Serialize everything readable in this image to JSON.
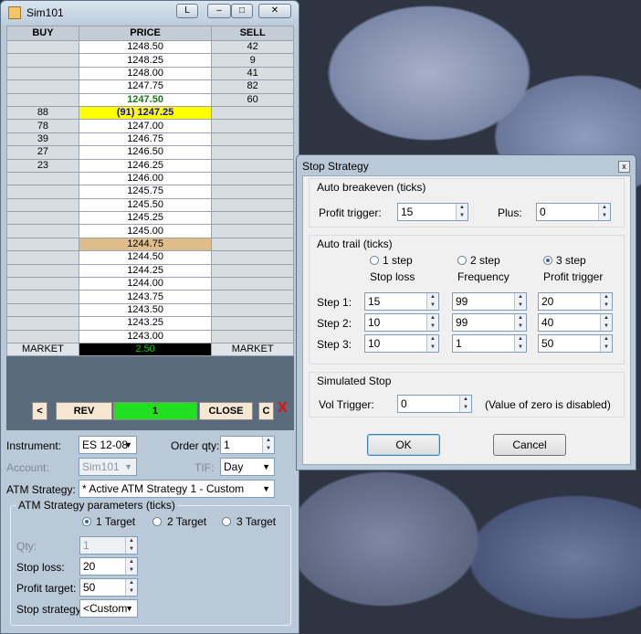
{
  "main_window": {
    "title": "Sim101",
    "btn_l": "L",
    "ladder": {
      "headers": {
        "buy": "BUY",
        "price": "PRICE",
        "sell": "SELL"
      },
      "rows": [
        {
          "buy": "",
          "price": "1248.50",
          "sell": "42",
          "style": ""
        },
        {
          "buy": "",
          "price": "1248.25",
          "sell": "9",
          "style": ""
        },
        {
          "buy": "",
          "price": "1248.00",
          "sell": "41",
          "style": ""
        },
        {
          "buy": "",
          "price": "1247.75",
          "sell": "82",
          "style": ""
        },
        {
          "buy": "",
          "price": "1247.50",
          "sell": "60",
          "style": "last"
        },
        {
          "buy": "88",
          "price": "(91) 1247.25",
          "sell": "",
          "style": "current"
        },
        {
          "buy": "78",
          "price": "1247.00",
          "sell": "",
          "style": ""
        },
        {
          "buy": "39",
          "price": "1246.75",
          "sell": "",
          "style": ""
        },
        {
          "buy": "27",
          "price": "1246.50",
          "sell": "",
          "style": ""
        },
        {
          "buy": "23",
          "price": "1246.25",
          "sell": "",
          "style": ""
        },
        {
          "buy": "",
          "price": "1246.00",
          "sell": "",
          "style": ""
        },
        {
          "buy": "",
          "price": "1245.75",
          "sell": "",
          "style": ""
        },
        {
          "buy": "",
          "price": "1245.50",
          "sell": "",
          "style": ""
        },
        {
          "buy": "",
          "price": "1245.25",
          "sell": "",
          "style": ""
        },
        {
          "buy": "",
          "price": "1245.00",
          "sell": "",
          "style": ""
        },
        {
          "buy": "",
          "price": "1244.75",
          "sell": "",
          "style": "highlight"
        },
        {
          "buy": "",
          "price": "1244.50",
          "sell": "",
          "style": ""
        },
        {
          "buy": "",
          "price": "1244.25",
          "sell": "",
          "style": ""
        },
        {
          "buy": "",
          "price": "1244.00",
          "sell": "",
          "style": ""
        },
        {
          "buy": "",
          "price": "1243.75",
          "sell": "",
          "style": ""
        },
        {
          "buy": "",
          "price": "1243.50",
          "sell": "",
          "style": ""
        },
        {
          "buy": "",
          "price": "1243.25",
          "sell": "",
          "style": ""
        },
        {
          "buy": "",
          "price": "1243.00",
          "sell": "",
          "style": ""
        }
      ],
      "footer": {
        "buy": "MARKET",
        "pnl": "2.50",
        "sell": "MARKET"
      }
    },
    "buttons": {
      "left": "<",
      "rev": "REV",
      "qty": "1",
      "close": "CLOSE",
      "c": "C",
      "x": "X"
    },
    "form": {
      "instrument_label": "Instrument:",
      "instrument_value": "ES 12-08",
      "order_qty_label": "Order qty:",
      "order_qty_value": "1",
      "account_label": "Account:",
      "account_value": "Sim101",
      "tif_label": "TIF:",
      "tif_value": "Day",
      "atm_label": "ATM Strategy:",
      "atm_value": "* Active ATM Strategy 1 - Custom",
      "params_title": "ATM Strategy parameters (ticks)",
      "target1": "1 Target",
      "target2": "2 Target",
      "target3": "3 Target",
      "qty_label": "Qty:",
      "qty_value": "1",
      "stop_loss_label": "Stop loss:",
      "stop_loss_value": "20",
      "profit_target_label": "Profit target:",
      "profit_target_value": "50",
      "stop_strategy_label": "Stop strategy:",
      "stop_strategy_value": "<Custom"
    }
  },
  "dialog": {
    "title": "Stop Strategy",
    "close": "x",
    "auto_breakeven": {
      "title": "Auto breakeven (ticks)",
      "profit_trigger_label": "Profit trigger:",
      "profit_trigger_value": "15",
      "plus_label": "Plus:",
      "plus_value": "0"
    },
    "auto_trail": {
      "title": "Auto trail (ticks)",
      "opt1": "1 step",
      "opt2": "2 step",
      "opt3": "3 step",
      "col1": "Stop loss",
      "col2": "Frequency",
      "col3": "Profit trigger",
      "step1_label": "Step 1:",
      "step2_label": "Step 2:",
      "step3_label": "Step 3:",
      "step1": [
        "15",
        "99",
        "20"
      ],
      "step2": [
        "10",
        "99",
        "40"
      ],
      "step3": [
        "10",
        "1",
        "50"
      ]
    },
    "simulated_stop": {
      "title": "Simulated Stop",
      "vol_label": "Vol Trigger:",
      "vol_value": "0",
      "note": "(Value of zero is disabled)"
    },
    "ok": "OK",
    "cancel": "Cancel"
  }
}
